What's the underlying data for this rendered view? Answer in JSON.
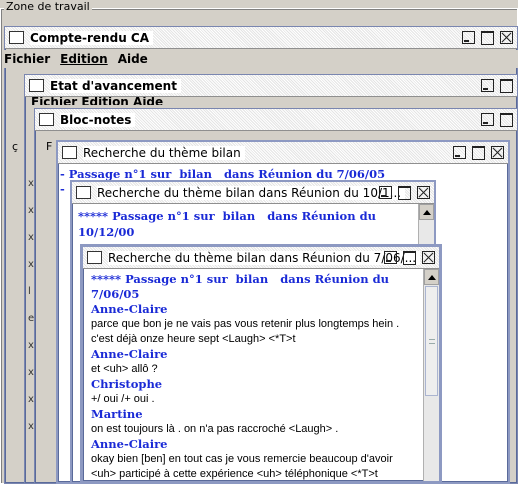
{
  "workspace": {
    "label": "Zone de travail"
  },
  "compte_rendu": {
    "title": "Compte-rendu CA",
    "menu": [
      "Fichier",
      "Edition",
      "Aide"
    ]
  },
  "etat": {
    "title": "Etat d'avancement",
    "menu_partial": "Fichier  Edition  Aide"
  },
  "blocnotes": {
    "title": "Bloc-notes"
  },
  "recherche1": {
    "title": "Recherche du thème bilan",
    "line1": "- Passage n°1 sur  bilan   dans Réunion du 7/06/05",
    "line2": "-"
  },
  "recherche2": {
    "title": "Recherche du thème  bilan  dans Réunion du 10/1...",
    "line1": "***** Passage n°1 sur  bilan   dans Réunion du",
    "line2": "10/12/00"
  },
  "recherche3": {
    "title": "Recherche du thème  bilan  dans Réunion du 7/06/...",
    "line1": "***** Passage n°1 sur  bilan   dans Réunion du",
    "line2": "7/06/05",
    "turns": [
      {
        "speaker": "Anne-Claire",
        "text": "parce que bon je ne vais pas vous retenir plus longtemps hein .\nc'est déjà onze heure sept <Laugh> <*T>t"
      },
      {
        "speaker": "Anne-Claire",
        "text": "et <uh> allô ?"
      },
      {
        "speaker": "Christophe",
        "text": "+/ oui /+ oui ."
      },
      {
        "speaker": "Martine",
        "text": "on est toujours là . on n'a pas raccroché <Laugh> ."
      },
      {
        "speaker": "Anne-Claire",
        "text": "okay bien [ben] en tout cas je vous remercie beaucoup d'avoir\n<uh> participé à cette expérience <uh> téléphonique <*T>t"
      }
    ]
  },
  "left_fragments": [
    "x",
    "x",
    "x",
    "x",
    "l",
    "e",
    "x",
    "x",
    "x",
    "x"
  ],
  "left_marks": [
    "ç",
    "F"
  ]
}
